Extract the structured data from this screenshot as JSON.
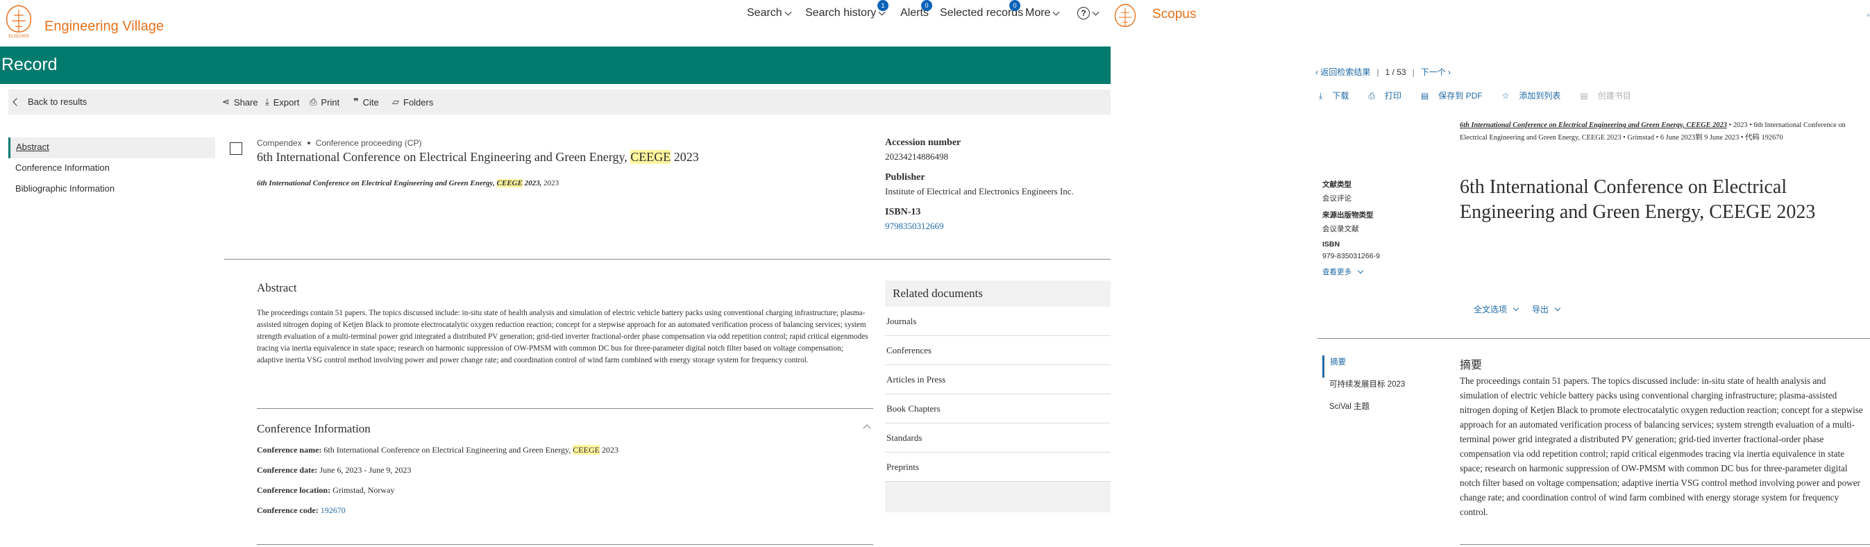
{
  "ev": {
    "brand": "Engineering Village",
    "nav": {
      "search": "Search",
      "search_history": "Search history",
      "search_history_count": "1",
      "alerts": "Alerts",
      "alerts_count": "0",
      "selected_records": "Selected records",
      "selected_records_count": "0",
      "more": "More",
      "help": "?"
    },
    "record_title": "Record",
    "toolbar": {
      "back": "Back to results",
      "share": "Share",
      "export": "Export",
      "print": "Print",
      "cite": "Cite",
      "folders": "Folders"
    },
    "sidenav": [
      "Abstract",
      "Conference Information",
      "Bibliographic Information"
    ],
    "doc": {
      "database": "Compendex",
      "doc_type": "Conference proceeding (CP)",
      "title_before": "6th International Conference on Electrical Engineering and Green Energy, ",
      "title_highlight": "CEEGE",
      "title_after": " 2023",
      "source_before": "6th International Conference on Electrical Engineering and Green Energy, ",
      "source_highlight": "CEEGE",
      "source_bold_after": " 2023,",
      "source_year": " 2023"
    },
    "meta": {
      "accession_label": "Accession number",
      "accession_value": "20234214886498",
      "publisher_label": "Publisher",
      "publisher_value": "Institute of Electrical and Electronics Engineers Inc.",
      "isbn_label": "ISBN-13",
      "isbn_value": "9798350312669"
    },
    "abstract": {
      "heading": "Abstract",
      "text": "The proceedings contain 51 papers. The topics discussed include: in-situ state of health analysis and simulation of electric vehicle battery packs using conventional charging infrastructure; plasma-assisted nitrogen doping of Ketjen Black to promote electrocatalytic oxygen reduction reaction; concept for a stepwise approach for an automated verification process of balancing services; system strength evaluation of a multi-terminal power grid integrated a distributed PV generation; grid-tied inverter fractional-order phase compensation via odd repetition control; rapid critical eigenmodes tracing via inertia equivalence in state space; research on harmonic suppression of OW-PMSM with common DC bus for three-parameter digital notch filter based on voltage compensation; adaptive inertia VSG control method involving power and power change rate; and coordination control of wind farm combined with energy storage system for frequency control."
    },
    "conference": {
      "heading": "Conference Information",
      "name_label": "Conference name:",
      "name_before": " 6th International Conference on Electrical Engineering and Green Energy, ",
      "name_highlight": "CEEGE",
      "name_after": " 2023",
      "date_label": "Conference date:",
      "date_value": " June 6, 2023 - June 9, 2023",
      "location_label": "Conference location:",
      "location_value": " Grimstad, Norway",
      "code_label": "Conference code:",
      "code_value": "192670"
    },
    "related": {
      "heading": "Related documents",
      "items": [
        "Journals",
        "Conferences",
        "Articles in Press",
        "Book Chapters",
        "Standards",
        "Preprints"
      ]
    }
  },
  "sc": {
    "brand": "Scopus",
    "pager": {
      "back": "返回检索结果",
      "current": "1",
      "slash": "/",
      "total": "53",
      "next": "下一个"
    },
    "actions": {
      "download": "下载",
      "print": "打印",
      "save_pdf": "保存到 PDF",
      "add_list": "添加到列表",
      "create_bib": "创建书目"
    },
    "source": {
      "title_bold": "6th International Conference on Electrical Engineering and Green Energy, CEEGE 2023",
      "rest": " • 2023 • 6th International Conference on Electrical Engineering and Green Energy, CEEGE 2023 • Grimstad • 6 June 2023到 9 June 2023 • 代码 192670"
    },
    "meta": {
      "doc_type_label": "文献类型",
      "doc_type_value": "会议评论",
      "source_type_label": "来源出版物类型",
      "source_type_value": "会议录文献",
      "isbn_label": "ISBN",
      "isbn_value": "979-835031266-9",
      "more": "查看更多"
    },
    "title": "6th International Conference on Electrical Engineering and Green Energy, CEEGE 2023",
    "options": {
      "fulltext": "全文选项",
      "export": "导出"
    },
    "tabs": [
      "摘要",
      "可持续发展目标 2023",
      "SciVal 主题"
    ],
    "abstract": {
      "heading": "摘要",
      "text": "The proceedings contain 51 papers. The topics discussed include: in-situ state of health analysis and simulation of electric vehicle battery packs using conventional charging infrastructure; plasma-assisted nitrogen doping of Ketjen Black to promote electrocatalytic oxygen reduction reaction; concept for a stepwise approach for an automated verification process of balancing services; system strength evaluation of a multi-terminal power grid integrated a distributed PV generation; grid-tied inverter fractional-order phase compensation via odd repetition control; rapid critical eigenmodes tracing via inertia equivalence in state space; research on harmonic suppression of OW-PMSM with common DC bus for three-parameter digital notch filter based on voltage compensation; adaptive inertia VSG control method involving power and power change rate; and coordination control of wind farm combined with energy storage system for frequency control."
    }
  }
}
